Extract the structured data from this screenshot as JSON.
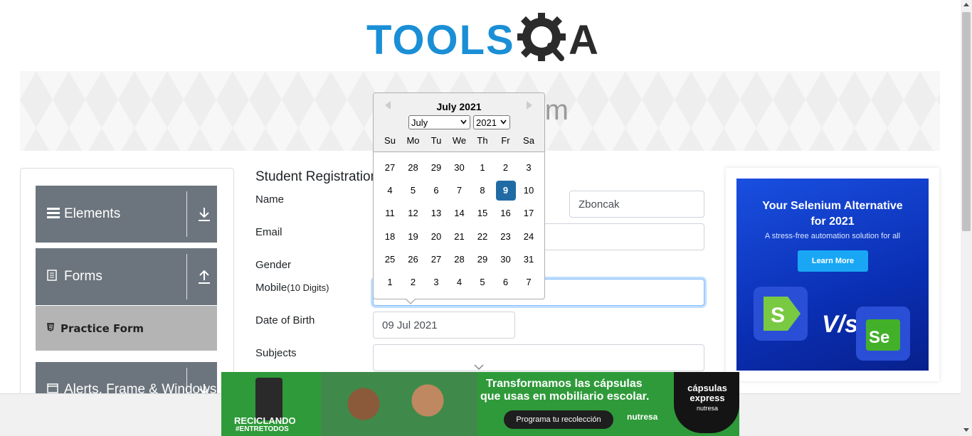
{
  "logo": {
    "text": "TOOLS",
    "text2": "A"
  },
  "banner": {
    "title": "Practice Form"
  },
  "sidebar": {
    "groups": [
      {
        "label": "Elements",
        "icon": "bars-icon",
        "arrow": "download-icon"
      },
      {
        "label": "Forms",
        "icon": "document-icon",
        "arrow": "upload-icon"
      },
      {
        "label": "Alerts, Frame & Windows",
        "icon": "window-icon",
        "arrow": "download-icon"
      }
    ],
    "active_item": {
      "label": "Practice Form",
      "icon": "html5-icon"
    }
  },
  "form": {
    "title": "Student Registration Form",
    "name_label": "Name",
    "last_name_value": "Zboncak",
    "email_label": "Email",
    "gender_label": "Gender",
    "mobile_label": "Mobile",
    "mobile_hint": "(10 Digits)",
    "dob_label": "Date of Birth",
    "dob_value": "09 Jul 2021",
    "subjects_label": "Subjects"
  },
  "datepicker": {
    "header": "July 2021",
    "month_select": "July",
    "year_select": "2021",
    "day_names": [
      "Su",
      "Mo",
      "Tu",
      "We",
      "Th",
      "Fr",
      "Sa"
    ],
    "weeks": [
      [
        "27",
        "28",
        "29",
        "30",
        "1",
        "2",
        "3"
      ],
      [
        "4",
        "5",
        "6",
        "7",
        "8",
        "9",
        "10"
      ],
      [
        "11",
        "12",
        "13",
        "14",
        "15",
        "16",
        "17"
      ],
      [
        "18",
        "19",
        "20",
        "21",
        "22",
        "23",
        "24"
      ],
      [
        "25",
        "26",
        "27",
        "28",
        "29",
        "30",
        "31"
      ],
      [
        "1",
        "2",
        "3",
        "4",
        "5",
        "6",
        "7"
      ]
    ],
    "selected_day": "9",
    "selected_color": "#216ba5"
  },
  "ad_right": {
    "title_line1": "Your Selenium Alternative",
    "title_line2": "for 2021",
    "subtitle": "A stress-free automation solution for all",
    "button": "Learn More",
    "vs": "V/s",
    "logo2_text": "Se"
  },
  "ad_bottom": {
    "left_line1": "RECICLANDO",
    "left_line2": "#ENTRETODOS",
    "headline_line1": "Transformamos las cápsulas",
    "headline_line2": "que usas en mobiliario escolar.",
    "button": "Programa tu recolección",
    "brand": "nutresa",
    "badge_line1": "cápsulas express",
    "badge_line2": "nutresa"
  },
  "colors": {
    "sidebar_header": "#6c757d",
    "active_item": "#b4b4b4",
    "logo_blue": "#1a8fd6",
    "logo_gray": "#2b2b2b"
  }
}
